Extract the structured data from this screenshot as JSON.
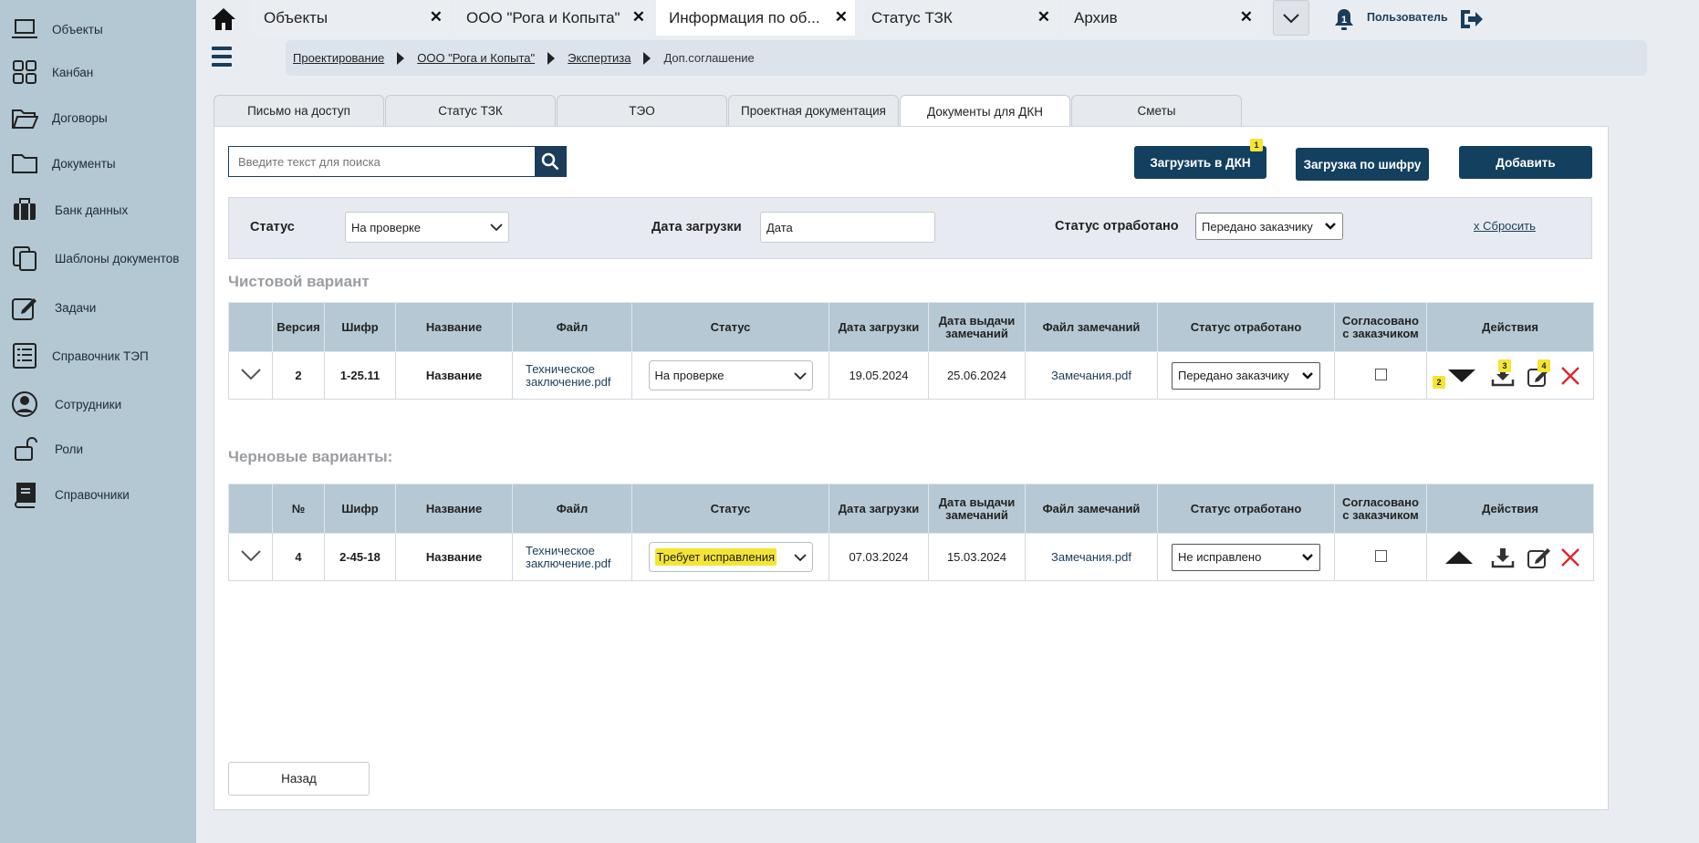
{
  "sidebar": {
    "items": [
      {
        "label": "Объекты",
        "icon": "laptop-icon"
      },
      {
        "label": "Канбан",
        "icon": "kanban-icon"
      },
      {
        "label": "Договоры",
        "icon": "folder-open-icon"
      },
      {
        "label": "Документы",
        "icon": "folder-icon"
      },
      {
        "label": "Банк данных",
        "icon": "briefcase-icon"
      },
      {
        "label": "Шаблоны документов",
        "icon": "copy-icon"
      },
      {
        "label": "Задачи",
        "icon": "edit-task-icon"
      },
      {
        "label": "Справочник ТЭП",
        "icon": "list-doc-icon"
      },
      {
        "label": "Сотрудники",
        "icon": "user-circle-icon"
      },
      {
        "label": "Роли",
        "icon": "lock-icon"
      },
      {
        "label": "Справочники",
        "icon": "book-icon"
      }
    ]
  },
  "tabs": [
    {
      "label": "Объекты",
      "active": false
    },
    {
      "label": "ООО \"Рога и Копыта\"",
      "active": false
    },
    {
      "label": "Информация по об...",
      "active": true
    },
    {
      "label": "Статус ТЗК",
      "active": false
    },
    {
      "label": "Архив",
      "active": false
    }
  ],
  "header": {
    "user": "Пользователь",
    "notifications": "1"
  },
  "breadcrumb": {
    "items": [
      "Проектирование",
      "ООО \"Рога и Копыта\"",
      "Экспертиза"
    ],
    "current": "Доп.соглашение"
  },
  "section_tabs": [
    {
      "label": "Письмо на доступ"
    },
    {
      "label": "Статус ТЗК"
    },
    {
      "label": "ТЭО"
    },
    {
      "label": "Проектная документация"
    },
    {
      "label": "Документы для ДКН",
      "active": true
    },
    {
      "label": "Сметы"
    }
  ],
  "search": {
    "placeholder": "Введите текст для поиска"
  },
  "toolbar": {
    "upload_dkn": "Загрузить в ДКН",
    "upload_dkn_badge": "1",
    "upload_code": "Загрузка по шифру",
    "add": "Добавить"
  },
  "filter": {
    "status_label": "Статус",
    "status_value": "На проверке",
    "date_label": "Дата загрузки",
    "date_value": "Дата",
    "worked_label": "Статус отработано",
    "worked_value": "Передано заказчику",
    "reset": "x Сбросить"
  },
  "clean": {
    "title": "Чистовой вариант",
    "headers": [
      "",
      "Версия",
      "Шифр",
      "Название",
      "Файл",
      "Статус",
      "Дата загрузки",
      "Дата выдачи замечаний",
      "Файл замечаний",
      "Статус отработано",
      "Согласовано с заказчиком",
      "Действия"
    ],
    "row": {
      "num": "2",
      "code": "1-25.11",
      "name": "Название",
      "file": "Техническое заключение.pdf",
      "status": "На проверке",
      "upload_date": "19.05.2024",
      "remarks_date": "25.06.2024",
      "remarks_file": "Замечания.pdf",
      "worked": "Передано заказчику",
      "badges": [
        "2",
        "3",
        "4"
      ]
    }
  },
  "draft": {
    "title": "Черновые варианты:",
    "headers": [
      "",
      "№",
      "Шифр",
      "Название",
      "Файл",
      "Статус",
      "Дата загрузки",
      "Дата выдачи замечаний",
      "Файл замечаний",
      "Статус отработано",
      "Согласовано с заказчиком",
      "Действия"
    ],
    "row": {
      "num": "4",
      "code": "2-45-18",
      "name": "Название",
      "file": "Техническое заключение.pdf",
      "status": "Требует исправления",
      "upload_date": "07.03.2024",
      "remarks_date": "15.03.2024",
      "remarks_file": "Замечания.pdf",
      "worked": "Не исправлено"
    }
  },
  "back": "Назад",
  "colors": {
    "sidebar": "#b3c8d3",
    "primary": "#13405f",
    "header_row": "#b5c8d4",
    "highlight": "#f4e534",
    "delete": "#e0242b"
  }
}
